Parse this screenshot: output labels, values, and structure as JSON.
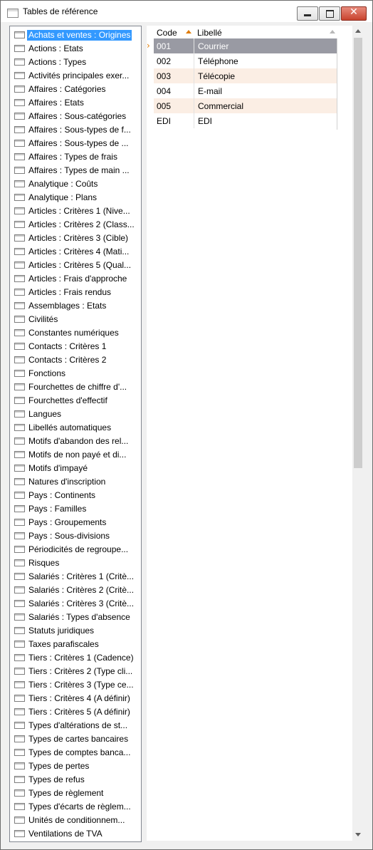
{
  "window": {
    "title": "Tables de référence"
  },
  "tree": {
    "items": [
      {
        "label": "Achats et ventes : Origines",
        "selected": true
      },
      {
        "label": "Actions : Etats"
      },
      {
        "label": "Actions : Types"
      },
      {
        "label": "Activités principales exer..."
      },
      {
        "label": "Affaires : Catégories"
      },
      {
        "label": "Affaires : Etats"
      },
      {
        "label": "Affaires : Sous-catégories"
      },
      {
        "label": "Affaires : Sous-types de f..."
      },
      {
        "label": "Affaires : Sous-types de ..."
      },
      {
        "label": "Affaires : Types de frais"
      },
      {
        "label": "Affaires : Types de main ..."
      },
      {
        "label": "Analytique : Coûts"
      },
      {
        "label": "Analytique : Plans"
      },
      {
        "label": "Articles : Critères 1 (Nive..."
      },
      {
        "label": "Articles : Critères 2 (Class..."
      },
      {
        "label": "Articles : Critères 3 (Cible)"
      },
      {
        "label": "Articles : Critères 4 (Mati..."
      },
      {
        "label": "Articles : Critères 5 (Qual..."
      },
      {
        "label": "Articles : Frais d'approche"
      },
      {
        "label": "Articles : Frais rendus"
      },
      {
        "label": "Assemblages : Etats"
      },
      {
        "label": "Civilités"
      },
      {
        "label": "Constantes numériques"
      },
      {
        "label": "Contacts : Critères 1"
      },
      {
        "label": "Contacts : Critères 2"
      },
      {
        "label": "Fonctions"
      },
      {
        "label": "Fourchettes de chiffre d'..."
      },
      {
        "label": "Fourchettes d'effectif"
      },
      {
        "label": "Langues"
      },
      {
        "label": "Libellés automatiques"
      },
      {
        "label": "Motifs d'abandon des rel..."
      },
      {
        "label": "Motifs de non payé et di..."
      },
      {
        "label": "Motifs d'impayé"
      },
      {
        "label": "Natures d'inscription"
      },
      {
        "label": "Pays : Continents"
      },
      {
        "label": "Pays : Familles"
      },
      {
        "label": "Pays : Groupements"
      },
      {
        "label": "Pays : Sous-divisions"
      },
      {
        "label": "Périodicités de regroupe..."
      },
      {
        "label": "Risques"
      },
      {
        "label": "Salariés : Critères 1 (Critè..."
      },
      {
        "label": "Salariés : Critères 2 (Critè..."
      },
      {
        "label": "Salariés : Critères 3 (Critè..."
      },
      {
        "label": "Salariés : Types d'absence"
      },
      {
        "label": "Statuts juridiques"
      },
      {
        "label": "Taxes parafiscales"
      },
      {
        "label": "Tiers : Critères 1 (Cadence)"
      },
      {
        "label": "Tiers : Critères 2 (Type cli..."
      },
      {
        "label": "Tiers : Critères 3 (Type ce..."
      },
      {
        "label": "Tiers : Critères 4 (A définir)"
      },
      {
        "label": "Tiers : Critères 5 (A définir)"
      },
      {
        "label": "Types d'altérations de st..."
      },
      {
        "label": "Types de cartes bancaires"
      },
      {
        "label": "Types de comptes banca..."
      },
      {
        "label": "Types de pertes"
      },
      {
        "label": "Types de refus"
      },
      {
        "label": "Types de règlement"
      },
      {
        "label": "Types d'écarts de règlem..."
      },
      {
        "label": "Unités de conditionnem..."
      },
      {
        "label": "Ventilations de TVA"
      }
    ]
  },
  "grid": {
    "columns": {
      "code": "Code",
      "libelle": "Libellé"
    },
    "sort": {
      "column": "code",
      "direction": "ascending"
    },
    "rows": [
      {
        "code": "001",
        "libelle": "Courrier",
        "current": true
      },
      {
        "code": "002",
        "libelle": "Téléphone"
      },
      {
        "code": "003",
        "libelle": "Télécopie"
      },
      {
        "code": "004",
        "libelle": "E-mail"
      },
      {
        "code": "005",
        "libelle": "Commercial"
      },
      {
        "code": "EDI",
        "libelle": "EDI"
      }
    ],
    "current_row_marker": "›"
  },
  "colors": {
    "selection": "#3399ff",
    "current_row": "#999aa3",
    "alt_row": "#fbeee4",
    "sort_indicator": "#e07b00",
    "close_button": "#c8432e"
  }
}
